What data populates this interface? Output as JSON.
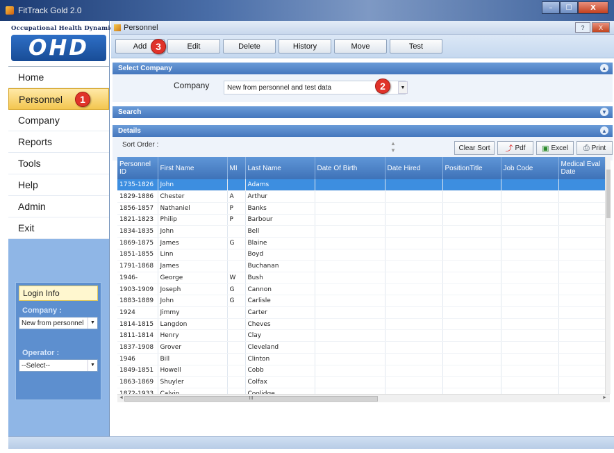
{
  "window": {
    "title": "FitTrack Gold 2.0",
    "min": "–",
    "max": "☐",
    "close": "X"
  },
  "logo": {
    "brand": "Occupational Health Dynamics",
    "mark": "OHD"
  },
  "nav": [
    {
      "label": "Home"
    },
    {
      "label": "Personnel"
    },
    {
      "label": "Company"
    },
    {
      "label": "Reports"
    },
    {
      "label": "Tools"
    },
    {
      "label": "Help"
    },
    {
      "label": "Admin"
    },
    {
      "label": "Exit"
    }
  ],
  "login": {
    "title": "Login Info",
    "company_label": "Company :",
    "company_value": "New from personnel",
    "operator_label": "Operator :",
    "operator_value": "--Select--"
  },
  "inner": {
    "title": "Personnel",
    "help": "?",
    "close": "X"
  },
  "toolbar": [
    "Add",
    "Edit",
    "Delete",
    "History",
    "Move",
    "Test"
  ],
  "markers": {
    "m1": "1",
    "m2": "2",
    "m3": "3"
  },
  "select_company": {
    "header": "Select Company",
    "label": "Company",
    "value": "New from personnel and test data"
  },
  "search": {
    "header": "Search"
  },
  "details": {
    "header": "Details",
    "sort_label": "Sort Order :",
    "buttons": {
      "clear_sort": "Clear Sort",
      "pdf": "Pdf",
      "excel": "Excel",
      "print": "Print"
    },
    "columns": [
      "Personnel ID",
      "First Name",
      "MI",
      "Last Name",
      "Date Of Birth",
      "Date Hired",
      "PositionTitle",
      "Job Code",
      "Medical Eval Date"
    ],
    "rows": [
      [
        "1735-1826",
        "John",
        "",
        "Adams"
      ],
      [
        "1829-1886",
        "Chester",
        "A",
        "Arthur"
      ],
      [
        "1856-1857",
        "Nathaniel",
        "P",
        "Banks"
      ],
      [
        "1821-1823",
        "Philip",
        "P",
        "Barbour"
      ],
      [
        "1834-1835",
        "John",
        "",
        "Bell"
      ],
      [
        "1869-1875",
        "James",
        "G",
        "Blaine"
      ],
      [
        "1851-1855",
        "Linn",
        "",
        "Boyd"
      ],
      [
        "1791-1868",
        "James",
        "",
        "Buchanan"
      ],
      [
        "1946-",
        "George",
        "W",
        "Bush"
      ],
      [
        "1903-1909",
        "Joseph",
        "G",
        "Cannon"
      ],
      [
        "1883-1889",
        "John",
        "G",
        "Carlisle"
      ],
      [
        "1924",
        "Jimmy",
        "",
        "Carter"
      ],
      [
        "1814-1815",
        "Langdon",
        "",
        "Cheves"
      ],
      [
        "1811-1814",
        "Henry",
        "",
        "Clay"
      ],
      [
        "1837-1908",
        "Grover",
        "",
        "Cleveland"
      ],
      [
        "1946",
        "Bill",
        "",
        "Clinton"
      ],
      [
        "1849-1851",
        "Howell",
        "",
        "Cobb"
      ],
      [
        "1863-1869",
        "Shuyler",
        "",
        "Colfax"
      ],
      [
        "1872-1933",
        "Calvin",
        "",
        "Coolidge"
      ]
    ],
    "selected_row": 0,
    "hscroll_thumb_label": "III"
  }
}
